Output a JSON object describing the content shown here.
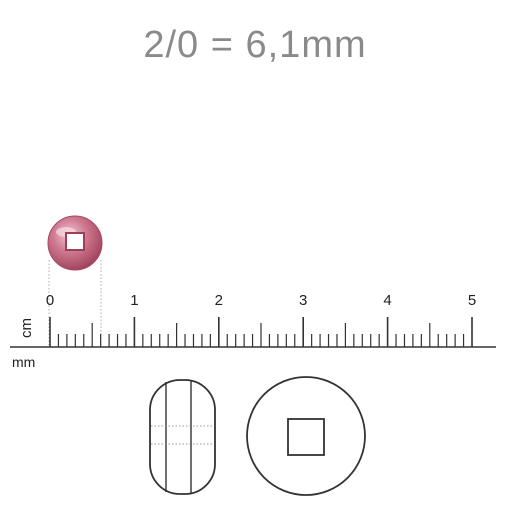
{
  "title": "2/0 = 6,1mm",
  "ruler": {
    "unit_cm": "cm",
    "unit_mm": "mm",
    "cm_labels": [
      "0",
      "1",
      "2",
      "3",
      "4",
      "5"
    ],
    "bead_size_mm": 6.1
  },
  "colors": {
    "bead": "#c06077",
    "bead_light": "#e7b4c2",
    "outline": "#333333",
    "title": "#8a8a8a"
  }
}
